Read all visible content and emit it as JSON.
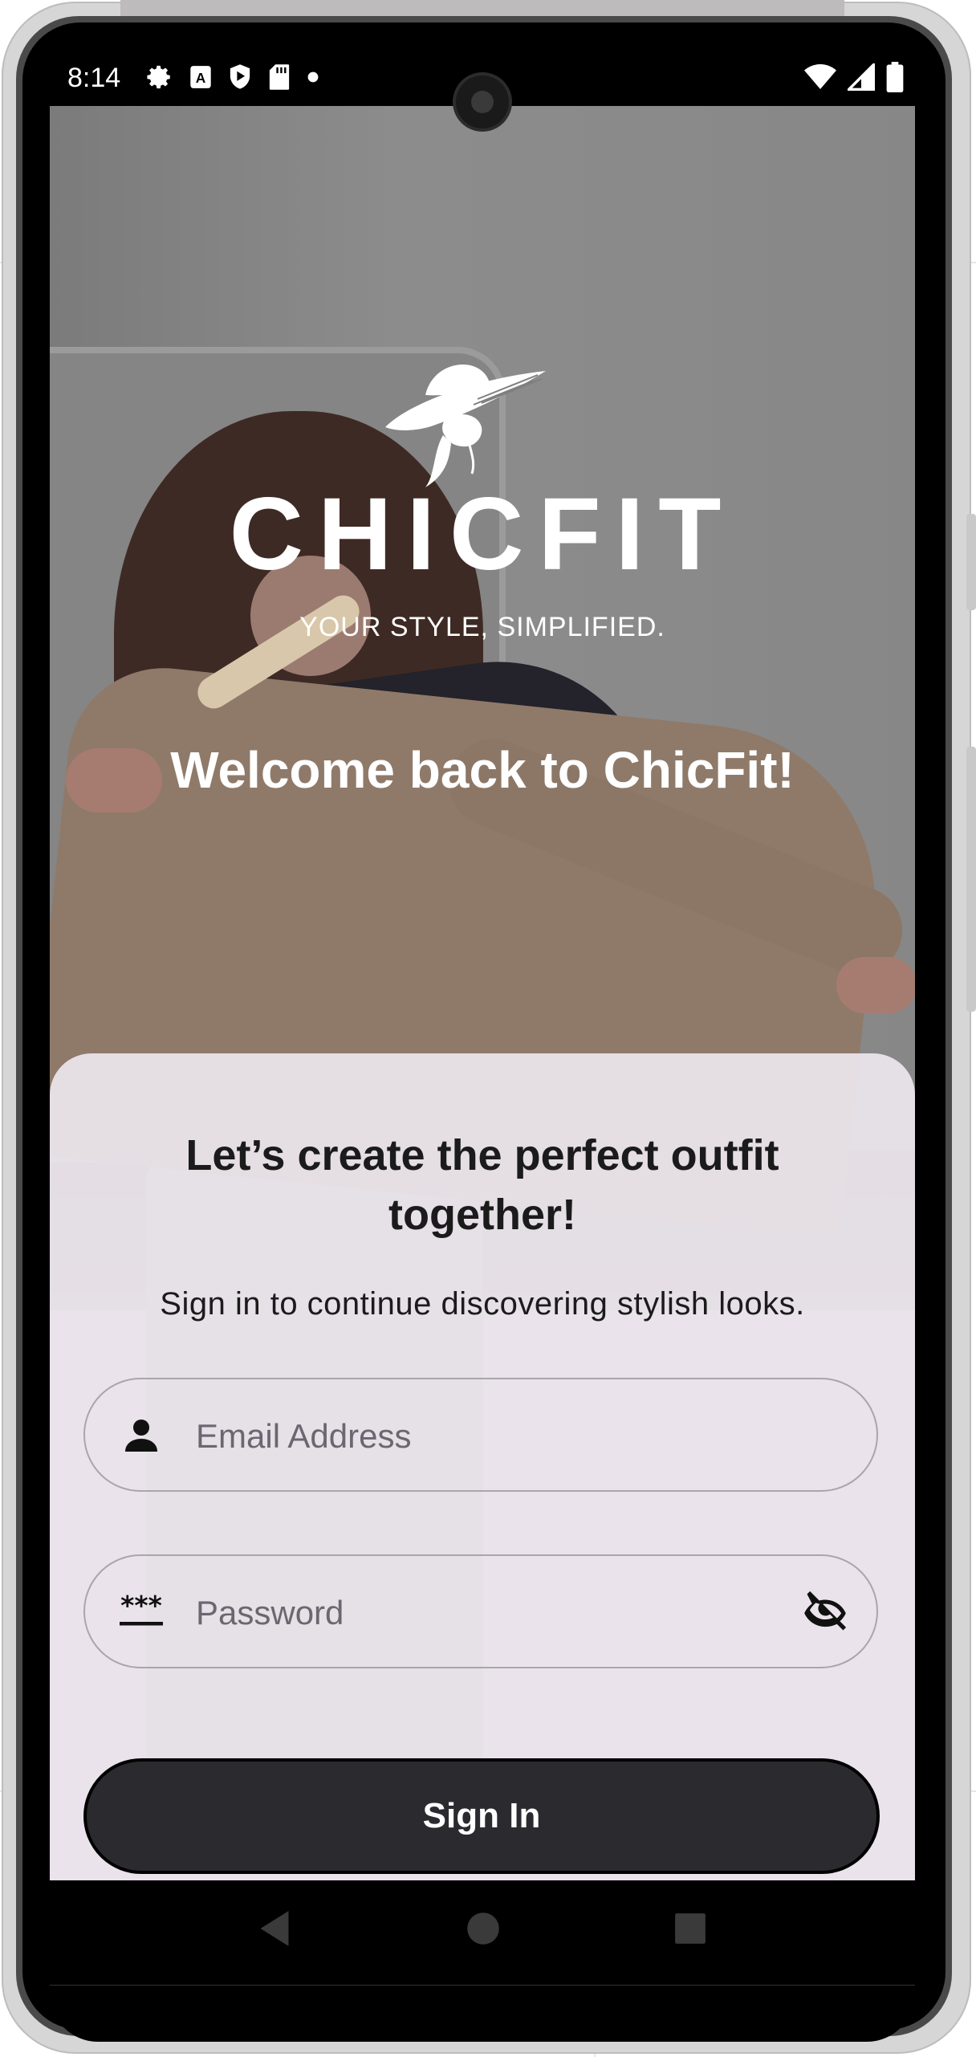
{
  "status_bar": {
    "time": "8:14",
    "left_icons": [
      "gear-icon",
      "a-icon",
      "shield-play-icon",
      "sd-card-icon",
      "dot-icon"
    ],
    "right_icons": [
      "wifi-icon",
      "signal-icon",
      "battery-icon"
    ]
  },
  "brand": {
    "name": "CHICFIT",
    "tagline": "YOUR STYLE, SIMPLIFIED."
  },
  "welcome": "Welcome back to ChicFit!",
  "card": {
    "title": "Let’s create the perfect outfit together!",
    "subtitle": "Sign in to continue discovering stylish looks.",
    "email": {
      "placeholder": "Email Address",
      "value": "",
      "icon": "person-icon"
    },
    "password": {
      "placeholder": "Password",
      "value": "",
      "icon": "password-icon",
      "toggle_icon": "eye-off-icon"
    },
    "signin_label": "Sign In"
  },
  "nav": {
    "back": "back-icon",
    "home": "home-icon",
    "recents": "recents-icon"
  },
  "colors": {
    "card_bg": "#ECE5ED",
    "button_bg": "#2B2A2E",
    "text_dark": "#1B1B1B",
    "white": "#FFFFFF"
  }
}
